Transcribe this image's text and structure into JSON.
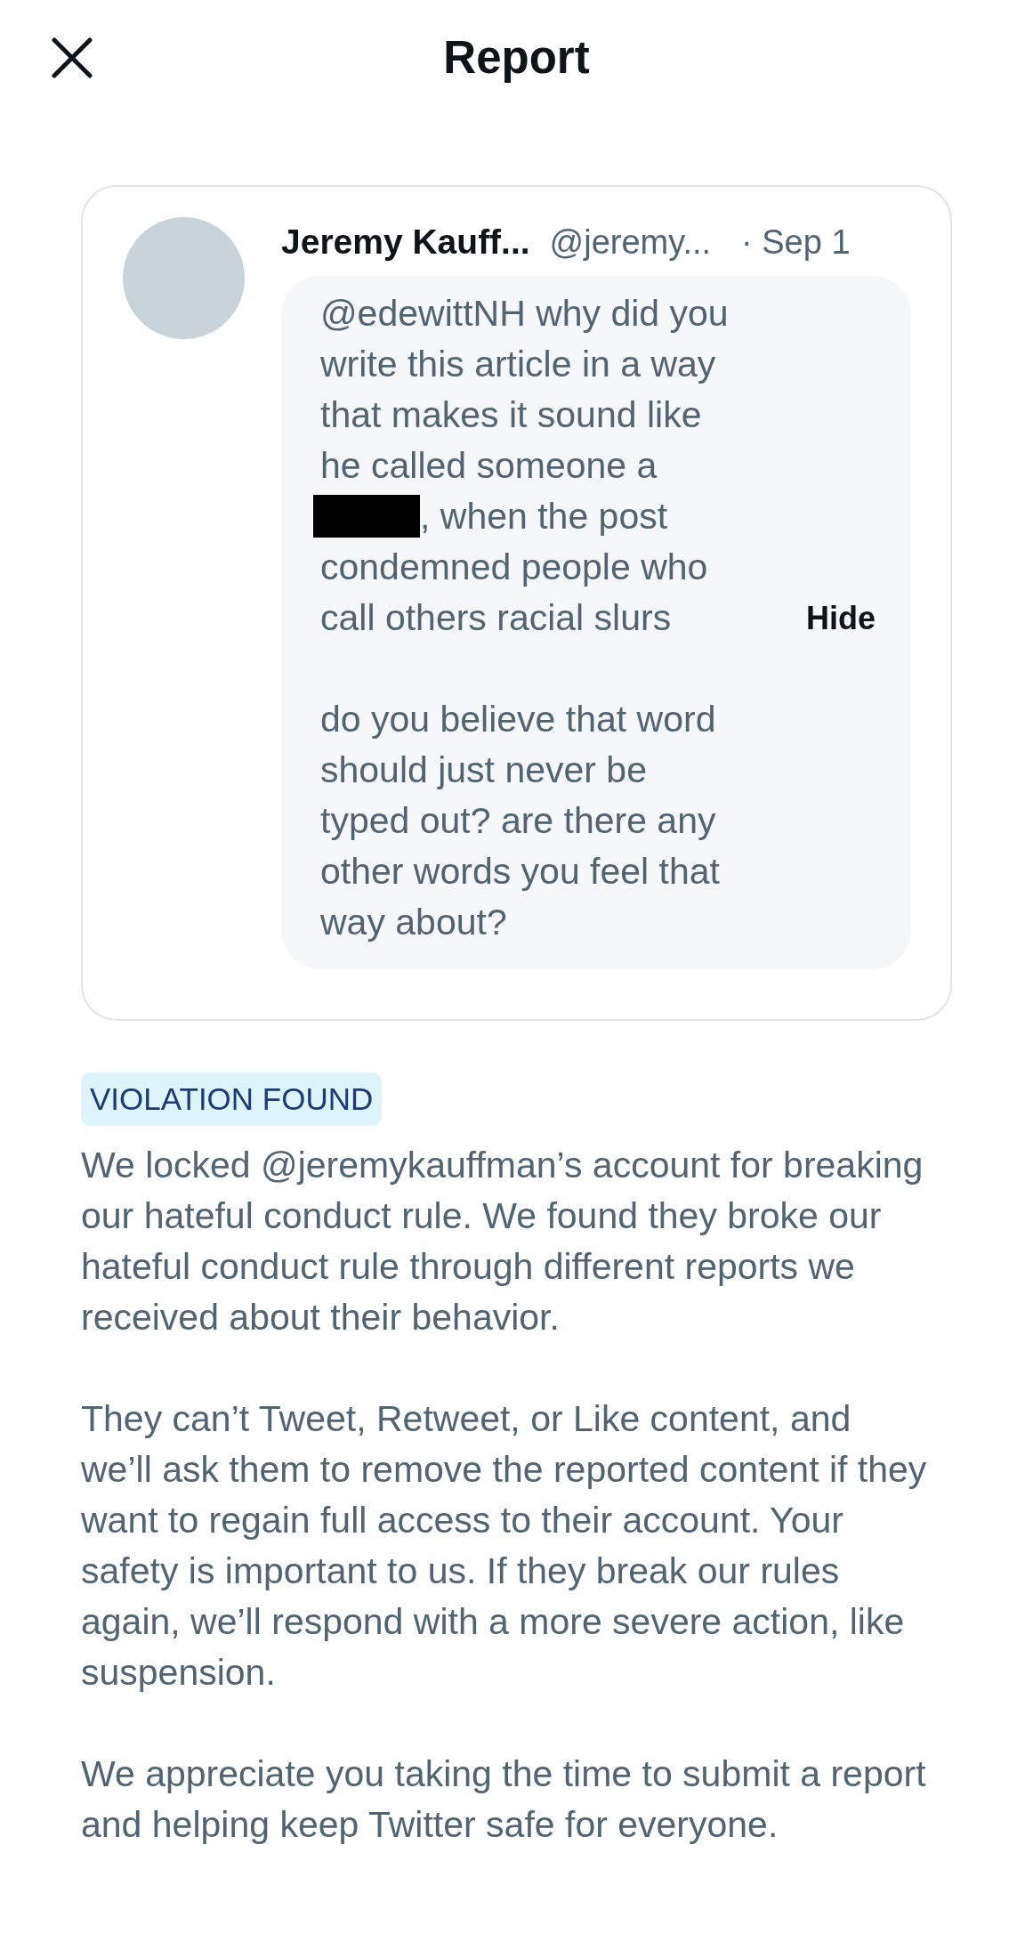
{
  "header": {
    "title": "Report"
  },
  "tweet": {
    "name": "Jeremy Kauff...",
    "handle": "@jeremy...",
    "date": "· Sep 1",
    "hide_label": "Hide",
    "paragraphs": [
      [
        {
          "kind": "plain",
          "text": "@edewittNH why did you"
        },
        {
          "kind": "plain",
          "text": "write this article in a way"
        },
        {
          "kind": "plain",
          "text": "that makes it sound like"
        },
        {
          "kind": "plain",
          "text": "he called someone a"
        },
        {
          "kind": "redacted",
          "text": ", when the post"
        },
        {
          "kind": "plain",
          "text": "condemned people who"
        },
        {
          "kind": "plain",
          "text": "call others racial slurs"
        }
      ],
      [
        {
          "kind": "plain",
          "text": "do you believe that word"
        },
        {
          "kind": "plain",
          "text": "should just never be"
        },
        {
          "kind": "plain",
          "text": "typed out? are there any"
        },
        {
          "kind": "plain",
          "text": "other words you feel that"
        },
        {
          "kind": "plain",
          "text": "way about?"
        }
      ]
    ]
  },
  "badge": "VIOLATION FOUND",
  "paragraphs": [
    [
      "We locked @jeremykauffman’s account for breaking",
      "our hateful conduct rule. We found they broke our",
      "hateful conduct rule through different reports we",
      "received about their behavior."
    ],
    [
      "They can’t Tweet, Retweet, or Like content, and",
      "we’ll ask them to remove the reported content if they",
      "want to regain full access to their account. Your",
      "safety is important to us. If they break our rules",
      "again, we’ll respond with a more severe action, like",
      "suspension."
    ],
    [
      "We appreciate you taking the time to submit a report",
      "and helping keep Twitter safe for everyone."
    ]
  ]
}
